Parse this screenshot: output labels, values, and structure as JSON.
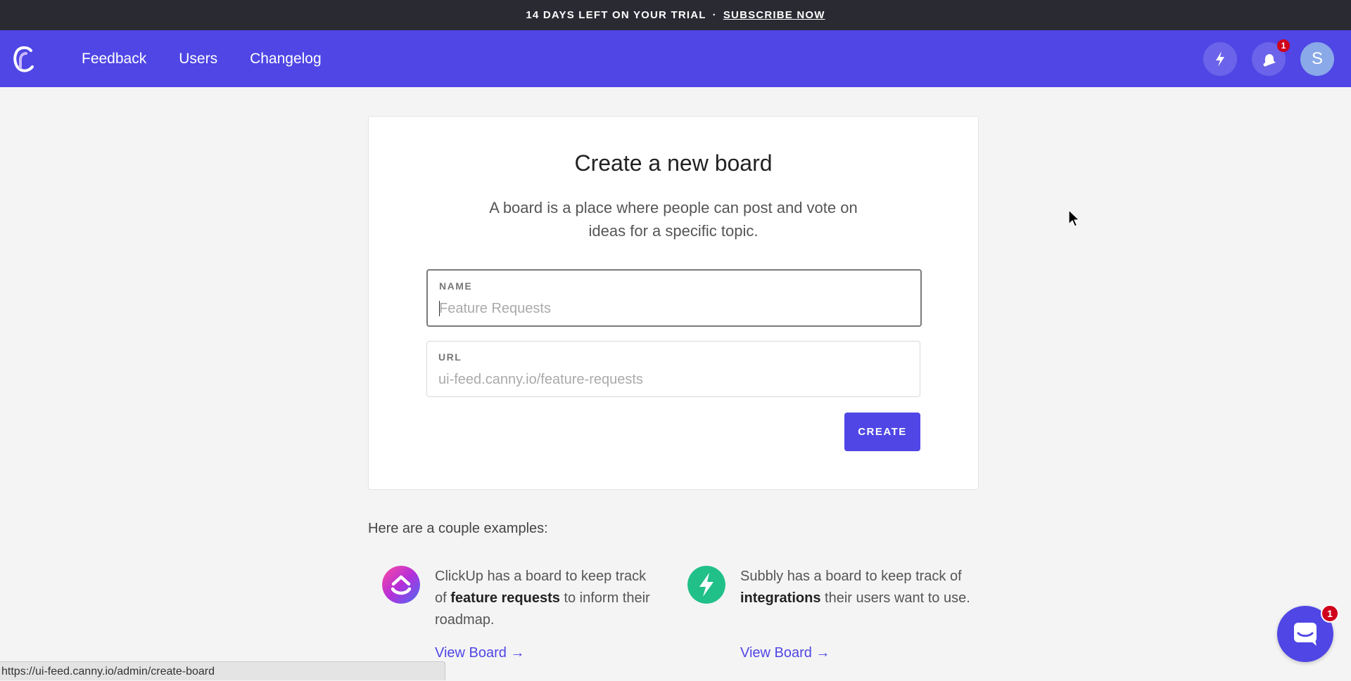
{
  "trial_bar": {
    "message": "14 DAYS LEFT ON YOUR TRIAL",
    "separator": "·",
    "cta": "SUBSCRIBE NOW"
  },
  "nav": {
    "links": [
      "Feedback",
      "Users",
      "Changelog"
    ],
    "notification_count": "1",
    "avatar_initial": "S",
    "icons": [
      "canny-logo-icon",
      "lightning-icon",
      "bell-icon"
    ],
    "brand_color": "#4f46e5"
  },
  "card": {
    "title": "Create a new board",
    "description": "A board is a place where people can post and vote on ideas for a specific topic.",
    "name_field": {
      "label": "NAME",
      "value": "",
      "placeholder": "Feature Requests"
    },
    "url_field": {
      "label": "URL",
      "value": "",
      "placeholder": "ui-feed.canny.io/feature-requests"
    },
    "create_label": "CREATE"
  },
  "examples": {
    "title": "Here are a couple examples:",
    "items": [
      {
        "text_before": "ClickUp has a board to keep track of ",
        "bold": "feature requests",
        "text_after": " to inform their roadmap.",
        "link": "View Board →",
        "icon": "clickup-logo-icon"
      },
      {
        "text_before": "Subbly has a board to keep track of ",
        "bold": "integrations",
        "text_after": " their users want to use.",
        "link": "View Board →",
        "icon": "subbly-logo-icon"
      }
    ]
  },
  "status_bar": {
    "url": "https://ui-feed.canny.io/admin/create-board"
  },
  "chat": {
    "badge": "1",
    "icon": "chat-icon"
  }
}
